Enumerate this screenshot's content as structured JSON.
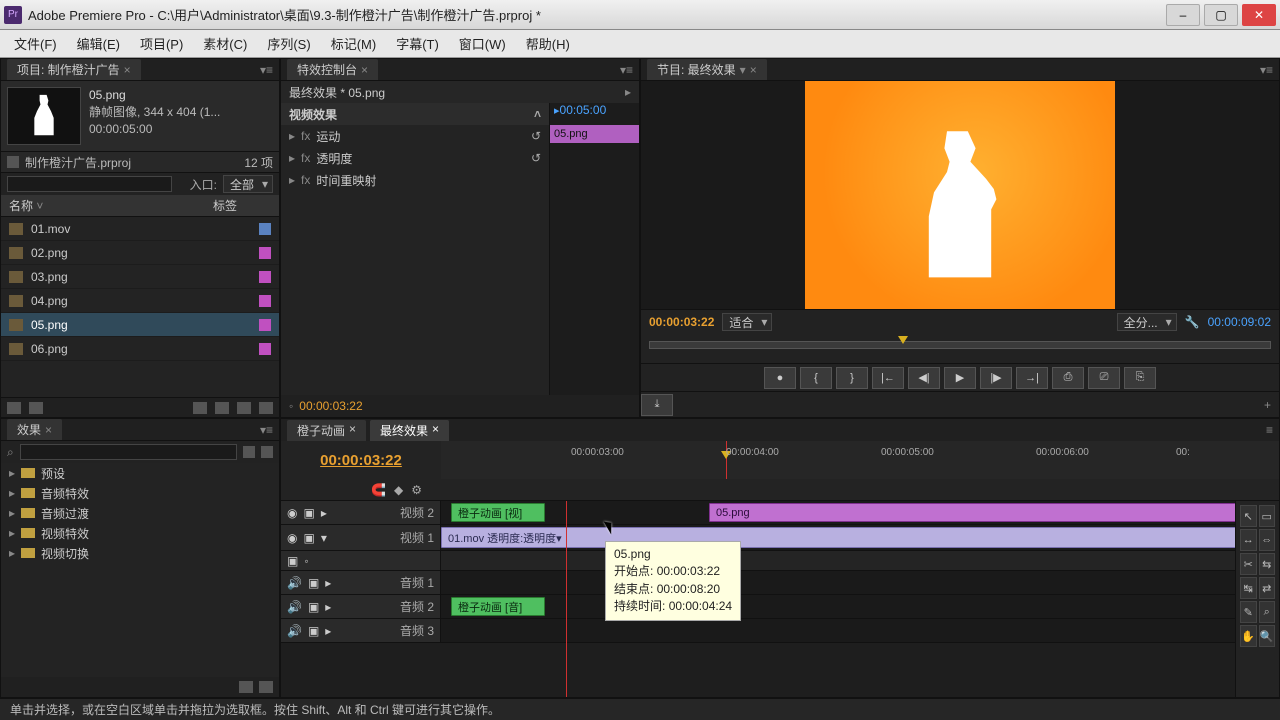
{
  "window": {
    "app_prefix": "Pr",
    "title": "Adobe Premiere Pro - C:\\用户\\Administrator\\桌面\\9.3-制作橙汁广告\\制作橙汁广告.prproj *"
  },
  "menus": [
    "文件(F)",
    "编辑(E)",
    "项目(P)",
    "素材(C)",
    "序列(S)",
    "标记(M)",
    "字幕(T)",
    "窗口(W)",
    "帮助(H)"
  ],
  "project_panel": {
    "tab": "项目: 制作橙汁广告",
    "selected_asset": "05.png",
    "meta1": "静帧图像, 344 x 404 (1...",
    "meta2": "00:00:05:00",
    "proj_file": "制作橙汁广告.prproj",
    "item_count": "12 项",
    "search_placeholder": "",
    "entry_label": "入口:",
    "entry_value": "全部",
    "col_name": "名称",
    "col_label": "标签",
    "assets": [
      "01.mov",
      "02.png",
      "03.png",
      "04.png",
      "05.png",
      "06.png"
    ]
  },
  "effects_controls": {
    "tab": "特效控制台",
    "clip_title": "最终效果 * 05.png",
    "group": "视频效果",
    "rows": [
      "运动",
      "透明度",
      "时间重映射"
    ],
    "side_tc": "00:05:00",
    "side_clip": "05.png",
    "footer_tc": "00:00:03:22"
  },
  "program": {
    "tab": "节目: 最终效果",
    "current_tc": "00:00:03:22",
    "fit_label": "适合",
    "full_label": "全分...",
    "duration_tc": "00:00:09:02",
    "transport_icons": [
      "●",
      "{",
      "}",
      "|←",
      "◀|",
      "▶",
      "|▶",
      "→|",
      "⎙",
      "⎚",
      "⎘"
    ]
  },
  "effects_browser": {
    "tab": "效果",
    "search_placeholder": "",
    "folders": [
      "预设",
      "音频特效",
      "音频过渡",
      "视频特效",
      "视频切换"
    ]
  },
  "timeline": {
    "tabs": [
      "橙子动画",
      "最终效果"
    ],
    "active_tab": 1,
    "current_tc": "00:00:03:22",
    "ruler": [
      "00:00:03:00",
      "00:00:04:00",
      "00:00:05:00",
      "00:00:06:00",
      "00:"
    ],
    "tracks": {
      "v2": "视频 2",
      "v1": "视频 1",
      "a1": "音频 1",
      "a2": "音频 2",
      "a3": "音频 3"
    },
    "clips": {
      "v2_a": "橙子动画 [视]",
      "v2_b": "05.png",
      "v1": "01.mov 透明度:透明度▾",
      "a2": "橙子动画 [音]"
    },
    "tooltip": {
      "name": "05.png",
      "start_label": "开始点:",
      "start": "00:00:03:22",
      "end_label": "结束点:",
      "end": "00:00:08:20",
      "dur_label": "持续时间:",
      "dur": "00:00:04:24"
    }
  },
  "statusbar": "单击并选择，或在空白区域单击并拖拉为选取框。按住 Shift、Alt 和 Ctrl 键可进行其它操作。",
  "tools": [
    "↖",
    "▭",
    "↔",
    "⇔",
    "✂",
    "⇆",
    "↹",
    "⇄",
    "✎",
    "⌕",
    "✋",
    "🔍"
  ]
}
